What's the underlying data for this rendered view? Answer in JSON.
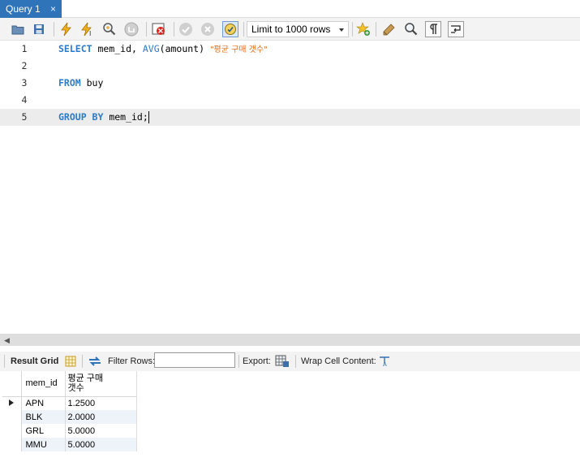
{
  "tab": {
    "label": "Query 1",
    "close_glyph": "×"
  },
  "toolbar": {
    "limit_select": "Limit to 1000 rows"
  },
  "editor": {
    "lines": [
      {
        "num": "1",
        "tokens": [
          [
            "kw",
            "SELECT"
          ],
          [
            "t",
            " mem_id, "
          ],
          [
            "fn",
            "AVG"
          ],
          [
            "t",
            "(amount) "
          ],
          [
            "str",
            "\"평균 구매 갯수\""
          ]
        ]
      },
      {
        "num": "2",
        "tokens": []
      },
      {
        "num": "3",
        "tokens": [
          [
            "kw",
            "FROM"
          ],
          [
            "t",
            " buy"
          ]
        ]
      },
      {
        "num": "4",
        "tokens": []
      },
      {
        "num": "5",
        "tokens": [
          [
            "kw",
            "GROUP BY"
          ],
          [
            "t",
            " mem_id;"
          ]
        ]
      }
    ]
  },
  "result_toolbar": {
    "result_grid": "Result Grid",
    "filter_rows": "Filter Rows:",
    "filter_value": "",
    "export": "Export:",
    "wrap_cell": "Wrap Cell Content:"
  },
  "grid": {
    "columns": [
      "mem_id",
      "평균 구매\n갯수"
    ],
    "rows": [
      [
        "APN",
        "1.2500"
      ],
      [
        "BLK",
        "2.0000"
      ],
      [
        "GRL",
        "5.0000"
      ],
      [
        "MMU",
        "5.0000"
      ]
    ]
  },
  "colors": {
    "tab_active": "#2f73b9",
    "keyword": "#2b7bc8",
    "string": "#e07020"
  },
  "icons": [
    "open-file-icon",
    "save-icon",
    "execute-icon",
    "execute-current-icon",
    "explain-icon",
    "stop-icon",
    "toggle-output-icon",
    "commit-icon",
    "rollback-icon",
    "autocommit-icon",
    "limit-dropdown",
    "bookmark-icon",
    "beautify-icon",
    "find-icon",
    "invisible-chars-icon",
    "wrap-lines-icon",
    "grid-icon",
    "refresh-icon",
    "export-icon",
    "wrap-cell-icon"
  ]
}
